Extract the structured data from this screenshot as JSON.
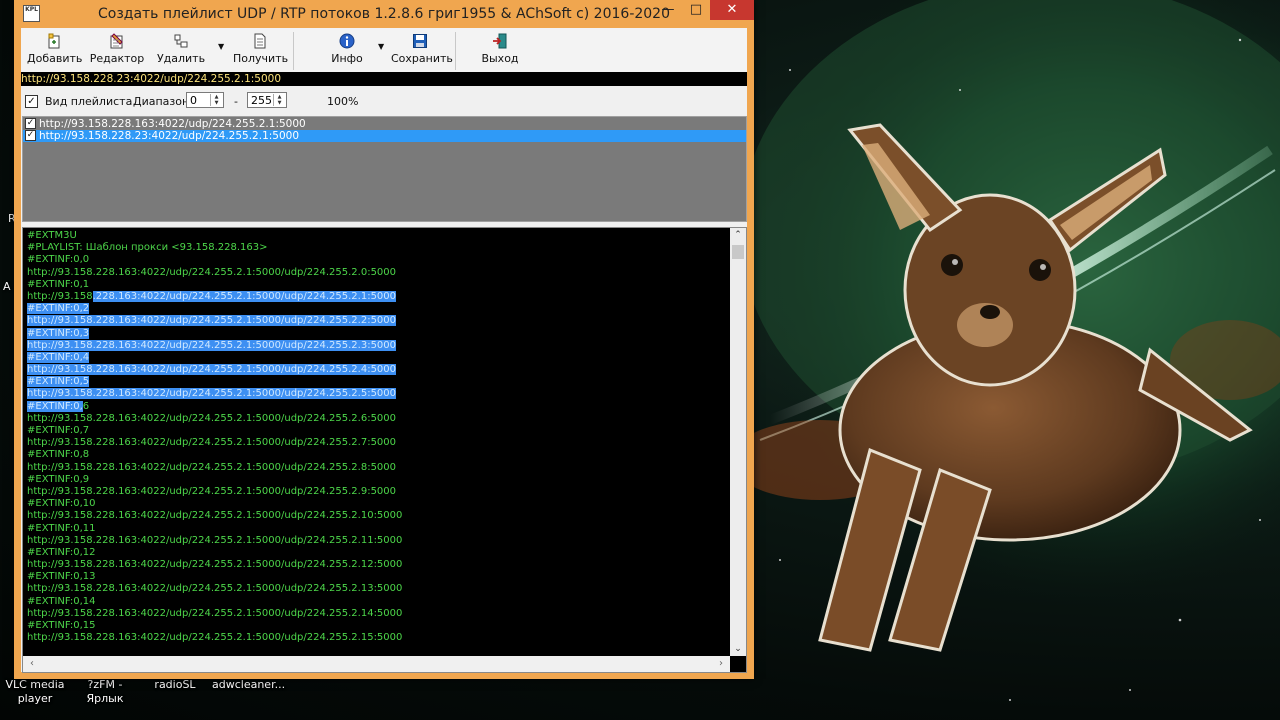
{
  "window": {
    "title": "Создать плейлист UDP / RTP потоков 1.2.8.6 григ1955 & AChSoft c) 2016-2020",
    "icon_text": "KPL"
  },
  "toolbar": {
    "add_label": "Добавить",
    "editor_label": "Редактор",
    "delete_label": "Удалить",
    "get_label": "Получить",
    "info_label": "Инфо",
    "save_label": "Сохранить",
    "exit_label": "Выход"
  },
  "url_bar": {
    "text": "http://93.158.228.23:4022/udp/224.255.2.1:5000"
  },
  "options": {
    "view_playlist_label": "Вид плейлиста.",
    "view_playlist_checked": true,
    "range_label": "Диапазон:",
    "range_from": "0",
    "range_dash": "-",
    "range_to": "255",
    "percent": "100%"
  },
  "playlist": {
    "items": [
      {
        "text": "http://93.158.228.163:4022/udp/224.255.2.1:5000",
        "checked": true,
        "selected": false
      },
      {
        "text": "http://93.158.228.23:4022/udp/224.255.2.1:5000",
        "checked": true,
        "selected": true
      }
    ]
  },
  "editor": {
    "lines": [
      "#EXTM3U",
      "#PLAYLIST: Шаблон прокси <93.158.228.163>",
      "#EXTINF:0,0",
      "http://93.158.228.163:4022/udp/224.255.2.1:5000/udp/224.255.2.0:5000",
      "#EXTINF:0,1",
      "http://93.158.228.163:4022/udp/224.255.2.1:5000/udp/224.255.2.1:5000",
      "#EXTINF:0,2",
      "http://93.158.228.163:4022/udp/224.255.2.1:5000/udp/224.255.2.2:5000",
      "#EXTINF:0,3",
      "http://93.158.228.163:4022/udp/224.255.2.1:5000/udp/224.255.2.3:5000",
      "#EXTINF:0,4",
      "http://93.158.228.163:4022/udp/224.255.2.1:5000/udp/224.255.2.4:5000",
      "#EXTINF:0,5",
      "http://93.158.228.163:4022/udp/224.255.2.1:5000/udp/224.255.2.5:5000",
      "#EXTINF:0,6",
      "http://93.158.228.163:4022/udp/224.255.2.1:5000/udp/224.255.2.6:5000",
      "#EXTINF:0,7",
      "http://93.158.228.163:4022/udp/224.255.2.1:5000/udp/224.255.2.7:5000",
      "#EXTINF:0,8",
      "http://93.158.228.163:4022/udp/224.255.2.1:5000/udp/224.255.2.8:5000",
      "#EXTINF:0,9",
      "http://93.158.228.163:4022/udp/224.255.2.1:5000/udp/224.255.2.9:5000",
      "#EXTINF:0,10",
      "http://93.158.228.163:4022/udp/224.255.2.1:5000/udp/224.255.2.10:5000",
      "#EXTINF:0,11",
      "http://93.158.228.163:4022/udp/224.255.2.1:5000/udp/224.255.2.11:5000",
      "#EXTINF:0,12",
      "http://93.158.228.163:4022/udp/224.255.2.1:5000/udp/224.255.2.12:5000",
      "#EXTINF:0,13",
      "http://93.158.228.163:4022/udp/224.255.2.1:5000/udp/224.255.2.13:5000",
      "#EXTINF:0,14",
      "http://93.158.228.163:4022/udp/224.255.2.1:5000/udp/224.255.2.14:5000",
      "#EXTINF:0,15",
      "http://93.158.228.163:4022/udp/224.255.2.1:5000/udp/224.255.2.15:5000"
    ]
  },
  "desktop": {
    "icons": [
      "VLC media player",
      "?zFM - Ярлык",
      "radioSL",
      "adwcleaner..."
    ],
    "edge_stubs": [
      "R",
      "A"
    ]
  },
  "colors": {
    "window_frame": "#f0a64f",
    "close_button": "#c7372f",
    "editor_text": "#4dd64a",
    "selection": "#2f9af7"
  }
}
